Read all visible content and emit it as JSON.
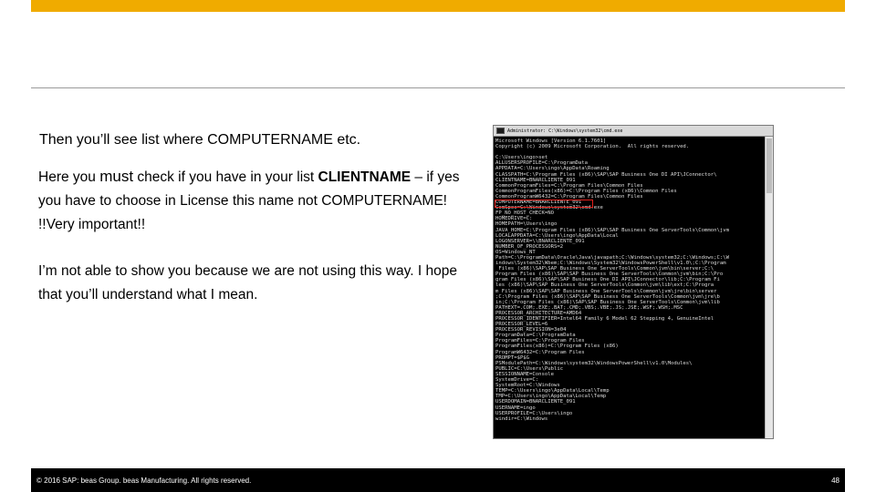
{
  "slide": {
    "heading": "Then you’ll see list where COMPUTERNAME etc.",
    "para1": {
      "part1": "Here you ",
      "emph": "must",
      "part2": " check if you have in your list ",
      "bold": "CLIENTNAME",
      "part3": " – if yes you have to choose in License this name not COMPUTERNAME! !!Very important!!"
    },
    "para2": "I’m not able to show you because we are not using this way. I hope that you’ll understand what I mean."
  },
  "terminal": {
    "title": "Administrator: C:\\Windows\\system32\\cmd.exe",
    "lines": [
      "Microsoft Windows [Version 6.1.7601]",
      "Copyright (c) 2009 Microsoft Corporation.  All rights reserved.",
      "",
      "C:\\Users\\ingo>set",
      "ALLUSERSPROFILE=C:\\ProgramData",
      "APPDATA=C:\\Users\\ingo\\AppData\\Roaming",
      "CLASSPATH=C:\\Program Files (x86)\\SAP\\SAP Business One DI API\\JConnector\\",
      "CLIENTNAME=BNARCLIENTE_091",
      "CommonProgramFiles=C:\\Program Files\\Common Files",
      "CommonProgramFiles(x86)=C:\\Program Files (x86)\\Common Files",
      "CommonProgramW6432=C:\\Program Files\\Common Files",
      "COMPUTERNAME=BNARCLIENTE_091",
      "ComSpec=C:\\Windows\\system32\\cmd.exe",
      "FP_NO_HOST_CHECK=NO",
      "HOMEDRIVE=C:",
      "HOMEPATH=\\Users\\ingo",
      "JAVA_HOME=C:\\Program Files (x86)\\SAP\\SAP Business One ServerTools\\Common\\jvm",
      "LOCALAPPDATA=C:\\Users\\ingo\\AppData\\Local",
      "LOGONSERVER=\\\\BNARCLIENTE_091",
      "NUMBER_OF_PROCESSORS=2",
      "OS=Windows_NT",
      "Path=C:\\ProgramData\\Oracle\\Java\\javapath;C:\\Windows\\system32;C:\\Windows;C:\\W",
      "indows\\System32\\Wbem;C:\\Windows\\System32\\WindowsPowerShell\\v1.0\\;C:\\Program",
      " Files (x86)\\SAP\\SAP Business One ServerTools\\Common\\jvm\\bin\\server;C:\\",
      "Program Files (x86)\\SAP\\SAP Business One ServerTools\\Common\\jvm\\bin;C:\\Pro",
      "gram Files (x86)\\SAP\\SAP Business One DI API\\JConnector\\lib;C:\\Program Fi",
      "les (x86)\\SAP\\SAP Business One ServerTools\\Common\\jvm\\lib\\ext;C:\\Progra",
      "m Files (x86)\\SAP\\SAP Business One ServerTools\\Common\\jvm\\jre\\bin\\server",
      ";C:\\Program Files (x86)\\SAP\\SAP Business One ServerTools\\Common\\jvm\\jre\\b",
      "in;C:\\Program Files (x86)\\SAP\\SAP Business One ServerTools\\Common\\jvm\\lib",
      "PATHEXT=.COM;.EXE;.BAT;.CMD;.VBS;.VBE;.JS;.JSE;.WSF;.WSH;.MSC",
      "PROCESSOR_ARCHITECTURE=AMD64",
      "PROCESSOR_IDENTIFIER=Intel64 Family 6 Model 62 Stepping 4, GenuineIntel",
      "PROCESSOR_LEVEL=6",
      "PROCESSOR_REVISION=3e04",
      "ProgramData=C:\\ProgramData",
      "ProgramFiles=C:\\Program Files",
      "ProgramFiles(x86)=C:\\Program Files (x86)",
      "ProgramW6432=C:\\Program Files",
      "PROMPT=$P$G",
      "PSModulePath=C:\\Windows\\system32\\WindowsPowerShell\\v1.0\\Modules\\",
      "PUBLIC=C:\\Users\\Public",
      "SESSIONNAME=Console",
      "SystemDrive=C:",
      "SystemRoot=C:\\Windows",
      "TEMP=C:\\Users\\ingo\\AppData\\Local\\Temp",
      "TMP=C:\\Users\\ingo\\AppData\\Local\\Temp",
      "USERDOMAIN=BNARCLIENTE_091",
      "USERNAME=ingo",
      "USERPROFILE=C:\\Users\\ingo",
      "windir=C:\\Windows"
    ]
  },
  "footer": {
    "copyright": "© 2016 SAP: beas Group. beas Manufacturing. All rights reserved.",
    "page": "48"
  },
  "colors": {
    "accent": "#f0ab00",
    "highlight": "#e0201b",
    "footer_bg": "#000000"
  }
}
